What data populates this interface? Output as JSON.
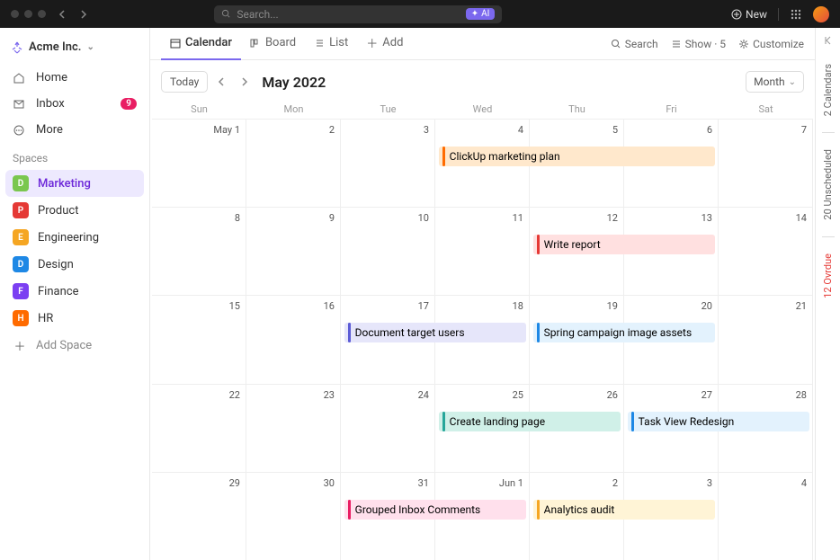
{
  "titlebar": {
    "search_placeholder": "Search...",
    "ai_label": "AI",
    "new_label": "New"
  },
  "workspace": {
    "name": "Acme Inc."
  },
  "nav": {
    "home": "Home",
    "inbox": "Inbox",
    "inbox_badge": "9",
    "more": "More"
  },
  "spaces": {
    "label": "Spaces",
    "items": [
      {
        "letter": "D",
        "name": "Marketing",
        "color": "#7ac74f",
        "active": true
      },
      {
        "letter": "P",
        "name": "Product",
        "color": "#e53935"
      },
      {
        "letter": "E",
        "name": "Engineering",
        "color": "#f5a623"
      },
      {
        "letter": "D",
        "name": "Design",
        "color": "#1e88e5"
      },
      {
        "letter": "F",
        "name": "Finance",
        "color": "#7b3ff2"
      },
      {
        "letter": "H",
        "name": "HR",
        "color": "#ff6b00"
      }
    ],
    "add": "Add Space"
  },
  "views": {
    "calendar": "Calendar",
    "board": "Board",
    "list": "List",
    "add": "Add",
    "search": "Search",
    "show": "Show · 5",
    "customize": "Customize"
  },
  "calendar": {
    "today": "Today",
    "title": "May 2022",
    "granularity": "Month",
    "dow": [
      "Sun",
      "Mon",
      "Tue",
      "Wed",
      "Thu",
      "Fri",
      "Sat"
    ],
    "weeks": [
      [
        {
          "d": "May 1"
        },
        {
          "d": "2"
        },
        {
          "d": "3"
        },
        {
          "d": "4"
        },
        {
          "d": "5"
        },
        {
          "d": "6"
        },
        {
          "d": "7"
        }
      ],
      [
        {
          "d": "8"
        },
        {
          "d": "9"
        },
        {
          "d": "10"
        },
        {
          "d": "11"
        },
        {
          "d": "12"
        },
        {
          "d": "13"
        },
        {
          "d": "14"
        }
      ],
      [
        {
          "d": "15"
        },
        {
          "d": "16"
        },
        {
          "d": "17"
        },
        {
          "d": "18"
        },
        {
          "d": "19"
        },
        {
          "d": "20"
        },
        {
          "d": "21"
        }
      ],
      [
        {
          "d": "22"
        },
        {
          "d": "23"
        },
        {
          "d": "24"
        },
        {
          "d": "25"
        },
        {
          "d": "26"
        },
        {
          "d": "27"
        },
        {
          "d": "28"
        }
      ],
      [
        {
          "d": "29"
        },
        {
          "d": "30"
        },
        {
          "d": "31"
        },
        {
          "d": "Jun 1"
        },
        {
          "d": "2"
        },
        {
          "d": "3"
        },
        {
          "d": "4"
        }
      ]
    ],
    "events": [
      {
        "title": "ClickUp marketing plan",
        "row": 0,
        "start": 3,
        "span": 3,
        "color": "orange"
      },
      {
        "title": "Write report",
        "row": 1,
        "start": 4,
        "span": 2,
        "color": "red"
      },
      {
        "title": "Document target users",
        "row": 2,
        "start": 2,
        "span": 2,
        "color": "indigo"
      },
      {
        "title": "Spring campaign image assets",
        "row": 2,
        "start": 4,
        "span": 2,
        "color": "blue"
      },
      {
        "title": "Create landing page",
        "row": 3,
        "start": 3,
        "span": 2,
        "color": "teal"
      },
      {
        "title": "Task View Redesign",
        "row": 3,
        "start": 5,
        "span": 2,
        "color": "blue"
      },
      {
        "title": "Grouped Inbox Comments",
        "row": 4,
        "start": 2,
        "span": 2,
        "color": "pink"
      },
      {
        "title": "Analytics audit",
        "row": 4,
        "start": 4,
        "span": 2,
        "color": "amber"
      }
    ]
  },
  "rail": {
    "calendars": "2 Calendars",
    "unscheduled": "20 Unscheduled",
    "overdue": "12 Ovrdue"
  }
}
